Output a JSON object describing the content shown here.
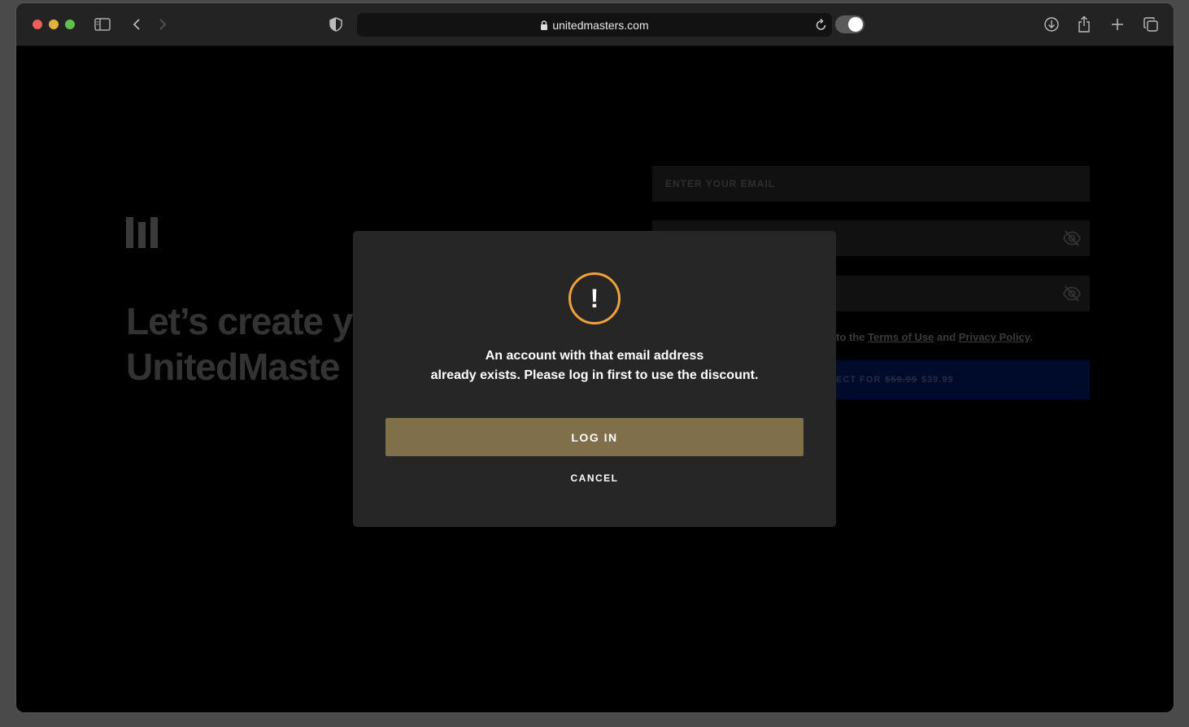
{
  "browser": {
    "url": "unitedmasters.com",
    "icons": [
      "sidebar-icon",
      "back-icon",
      "forward-icon",
      "shield-icon",
      "lock-icon",
      "reload-icon",
      "download-icon",
      "share-icon",
      "new-tab-icon",
      "tabs-overview-icon"
    ]
  },
  "page": {
    "headline_line1": "Let’s create y",
    "headline_line2": "UnitedMaste",
    "email_placeholder": "ENTER YOUR EMAIL",
    "terms_prefix": "to the ",
    "terms_link": "Terms of Use",
    "terms_and": " and ",
    "privacy_link": "Privacy Policy",
    "terms_suffix": ".",
    "submit_prefix": "ECT FOR",
    "old_price": "$59.99",
    "new_price": "$39.99"
  },
  "modal": {
    "icon": "!",
    "message_line1": "An account with that email address",
    "message_line2": "already exists. Please log in first to use the discount.",
    "login_label": "LOG IN",
    "cancel_label": "CANCEL",
    "accent_color": "#f0a13a",
    "button_color": "#7f704b"
  }
}
